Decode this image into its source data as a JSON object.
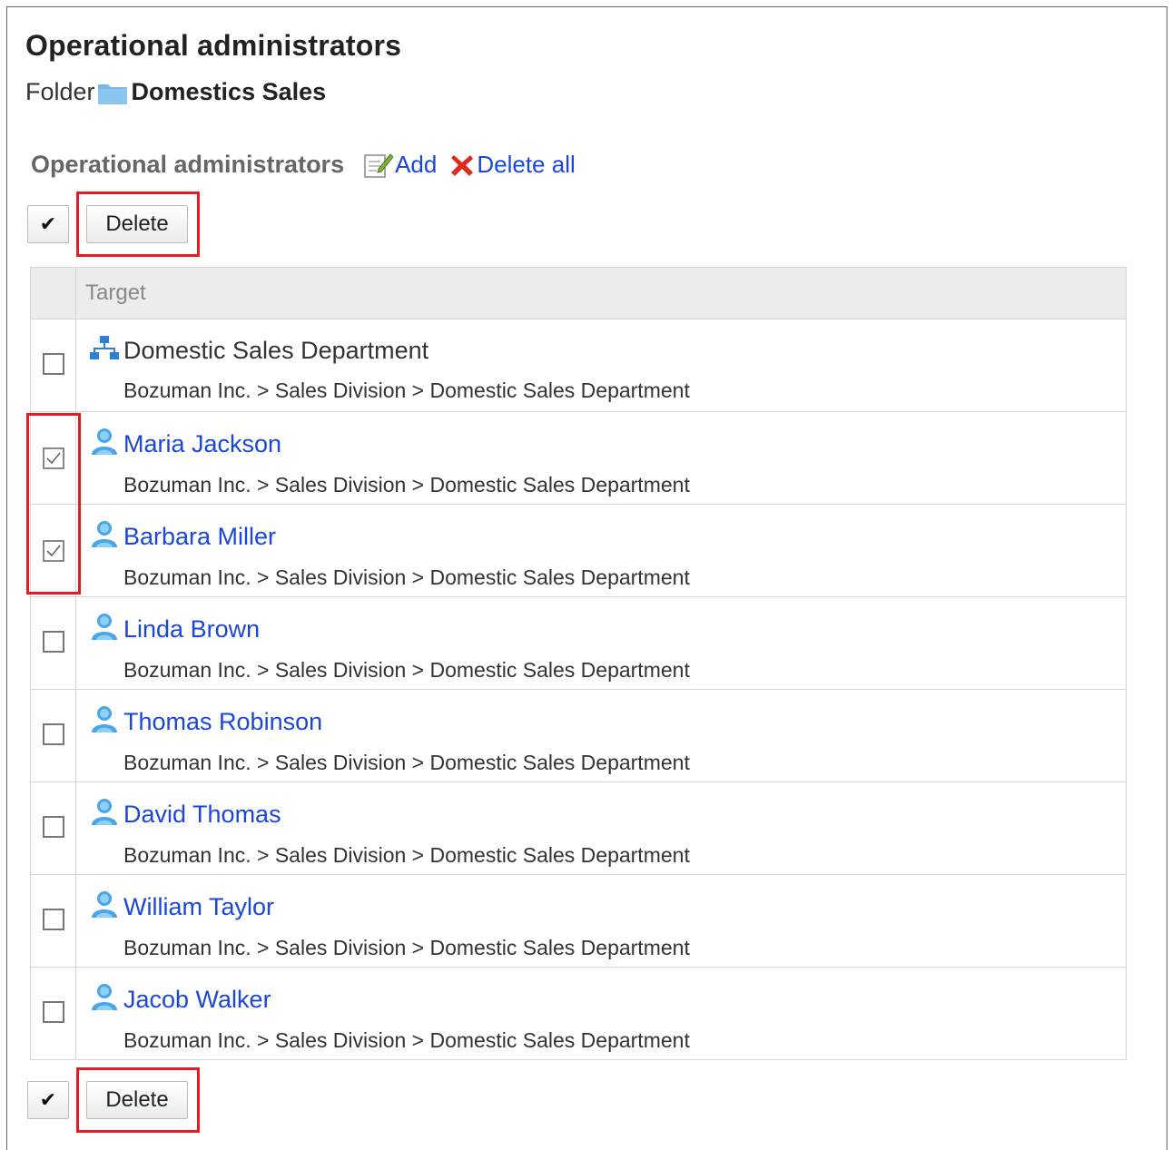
{
  "page": {
    "title": "Operational administrators",
    "folder_label": "Folder",
    "folder_name": "Domestics Sales"
  },
  "section": {
    "title": "Operational administrators",
    "add_label": "Add",
    "delete_all_label": "Delete all"
  },
  "toolbar": {
    "check_all_glyph": "✔",
    "delete_label": "Delete"
  },
  "table": {
    "header": "Target",
    "rows": [
      {
        "type": "organization",
        "name": "Domestic Sales Department",
        "path": "Bozuman Inc. > Sales Division > Domestic Sales Department",
        "checked": false
      },
      {
        "type": "user",
        "name": "Maria Jackson",
        "path": "Bozuman Inc. > Sales Division > Domestic Sales Department",
        "checked": true
      },
      {
        "type": "user",
        "name": "Barbara Miller",
        "path": "Bozuman Inc. > Sales Division > Domestic Sales Department",
        "checked": true
      },
      {
        "type": "user",
        "name": "Linda Brown",
        "path": "Bozuman Inc. > Sales Division > Domestic Sales Department",
        "checked": false
      },
      {
        "type": "user",
        "name": "Thomas Robinson",
        "path": "Bozuman Inc. > Sales Division > Domestic Sales Department",
        "checked": false
      },
      {
        "type": "user",
        "name": "David Thomas",
        "path": "Bozuman Inc. > Sales Division > Domestic Sales Department",
        "checked": false
      },
      {
        "type": "user",
        "name": "William Taylor",
        "path": "Bozuman Inc. > Sales Division > Domestic Sales Department",
        "checked": false
      },
      {
        "type": "user",
        "name": "Jacob Walker",
        "path": "Bozuman Inc. > Sales Division > Domestic Sales Department",
        "checked": false
      }
    ]
  },
  "colors": {
    "link": "#1a47d8",
    "highlight": "#e41b23",
    "header_bg": "#ececec",
    "user_icon": "#4aa6e6",
    "org_icon": "#2f7fd6"
  }
}
